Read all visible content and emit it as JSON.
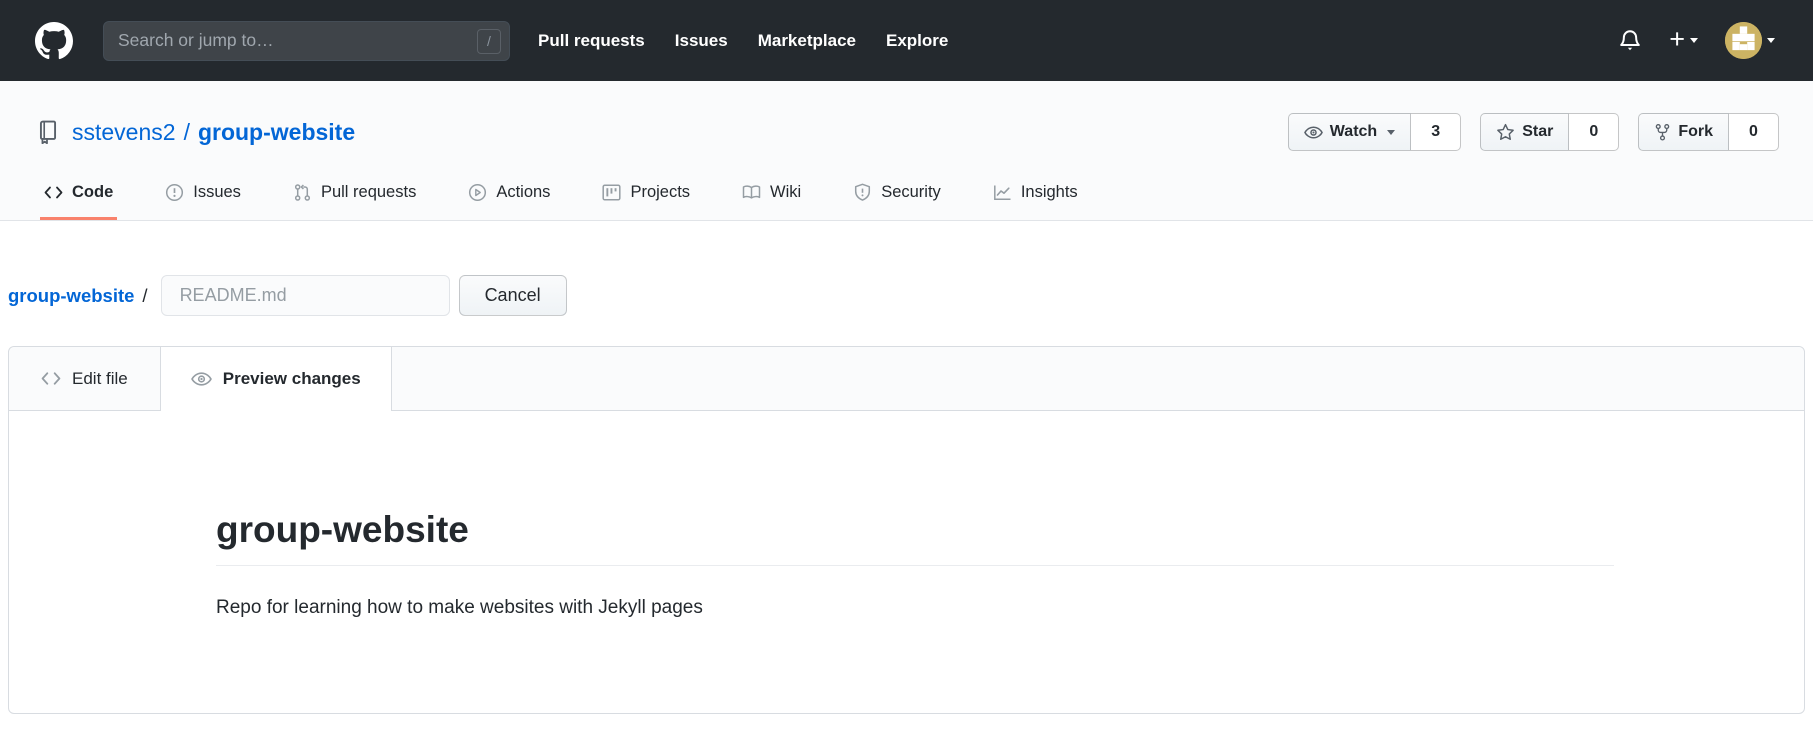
{
  "colors": {
    "header_bg": "#24292e",
    "accent_blue": "#0366d6",
    "active_tab_underline": "#f9826c",
    "avatar_tan": "#ccb363",
    "muted_gray": "#959da3"
  },
  "header": {
    "search_placeholder": "Search or jump to…",
    "slash_hint": "/",
    "nav": [
      {
        "label": "Pull requests"
      },
      {
        "label": "Issues"
      },
      {
        "label": "Marketplace"
      },
      {
        "label": "Explore"
      }
    ]
  },
  "repo": {
    "owner": "sstevens2",
    "separator": "/",
    "name": "group-website",
    "social": [
      {
        "label": "Watch",
        "count": "3"
      },
      {
        "label": "Star",
        "count": "0"
      },
      {
        "label": "Fork",
        "count": "0"
      }
    ],
    "tabs": [
      {
        "label": "Code"
      },
      {
        "label": "Issues"
      },
      {
        "label": "Pull requests"
      },
      {
        "label": "Actions"
      },
      {
        "label": "Projects"
      },
      {
        "label": "Wiki"
      },
      {
        "label": "Security"
      },
      {
        "label": "Insights"
      }
    ]
  },
  "editor": {
    "breadcrumb": {
      "repo": "group-website",
      "separator": "/"
    },
    "filename": "README.md",
    "cancel_label": "Cancel",
    "tabs": [
      {
        "label": "Edit file"
      },
      {
        "label": "Preview changes"
      }
    ]
  },
  "preview": {
    "title": "group-website",
    "description": "Repo for learning how to make websites with Jekyll pages"
  }
}
